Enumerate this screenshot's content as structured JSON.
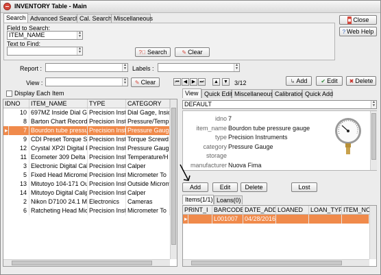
{
  "title": "INVENTORY Table - Main",
  "top_tabs": [
    "Search",
    "Advanced Search",
    "Cal. Search",
    "Miscellaneous"
  ],
  "search": {
    "field_label": "Field to Search:",
    "field_value": "ITEM_NAME",
    "text_label": "Text to Find:",
    "text_value": "",
    "search_btn": "Search",
    "clear_btn": "Clear"
  },
  "buttons": {
    "close": "Close",
    "web_help": "Web Help",
    "add": "Add",
    "edit": "Edit",
    "delete": "Delete",
    "clear": "Clear"
  },
  "filters": {
    "report_label": "Report :",
    "labels_label": "Labels :",
    "view_label": "View :",
    "record_count": "3/12"
  },
  "display_each_item": "Display Each Item",
  "main_table": {
    "columns": [
      "IDNO",
      "ITEM_NAME",
      "TYPE",
      "CATEGORY"
    ],
    "rows": [
      [
        "10",
        "697MZ Inside Dial Ga",
        "Precision Instr",
        "Dial Gage, Insid"
      ],
      [
        "8",
        "Barton Chart Recorde",
        "Precision Instr",
        "Pressure/Temp"
      ],
      [
        "7",
        "Bourdon tube pressur",
        "Precision Instr",
        "Pressure Gauge"
      ],
      [
        "9",
        "CDI Preset Torque S",
        "Precision Instr",
        "Torque Screwd"
      ],
      [
        "12",
        "Crystal XP2I Digital P",
        "Precision Instr",
        "Pressure Gaug"
      ],
      [
        "11",
        "Ecometer 309 Delta T",
        "Precision Instr",
        "Temperature/H"
      ],
      [
        "3",
        "Electronic Digital Calip",
        "Precision Instr",
        "Calper"
      ],
      [
        "5",
        "Fixed Head Micromet",
        "Precision Instr",
        "Micrometer To"
      ],
      [
        "13",
        "Mitutoyo 104-171 Ou",
        "Precision Instr",
        "Outside Microm"
      ],
      [
        "14",
        "Mitutoyo Digital Calip",
        "Precision Instr",
        "Calper"
      ],
      [
        "2",
        "Nikon D7100 24.1 MF",
        "Electronics",
        "Cameras"
      ],
      [
        "6",
        "Ratcheting Head Micr",
        "Precision Instr",
        "Micrometer To"
      ]
    ],
    "selected_row": 2
  },
  "right_tabs": [
    "View",
    "Quick Edit",
    "Miscellaneous",
    "Calibration",
    "Quick Add"
  ],
  "view_select": "DEFAULT",
  "detail": {
    "labels": [
      "idno",
      "item_name",
      "type",
      "category",
      "storage",
      "manufacturer"
    ],
    "values": [
      "7",
      "Bourdon tube pressure gauge",
      "Precision Instruments",
      "Pressure Gauge",
      "",
      "Nuova Fima"
    ]
  },
  "sub_buttons": [
    "Add",
    "Edit",
    "Delete",
    "Lost"
  ],
  "bottom_tabs": [
    "Items(1/1)",
    "Loans(0)"
  ],
  "items_table": {
    "columns": [
      "PRINT_I",
      "BARCODE",
      "DATE_ADDI",
      "LOANED",
      "LOAN_TYPI",
      "ITEM_NOTI"
    ],
    "rows": [
      [
        "",
        "L001007",
        "04/28/2016",
        "",
        "",
        ""
      ]
    ]
  },
  "colors": {
    "selection": "#f08a4b",
    "accent": "#d5473b"
  }
}
